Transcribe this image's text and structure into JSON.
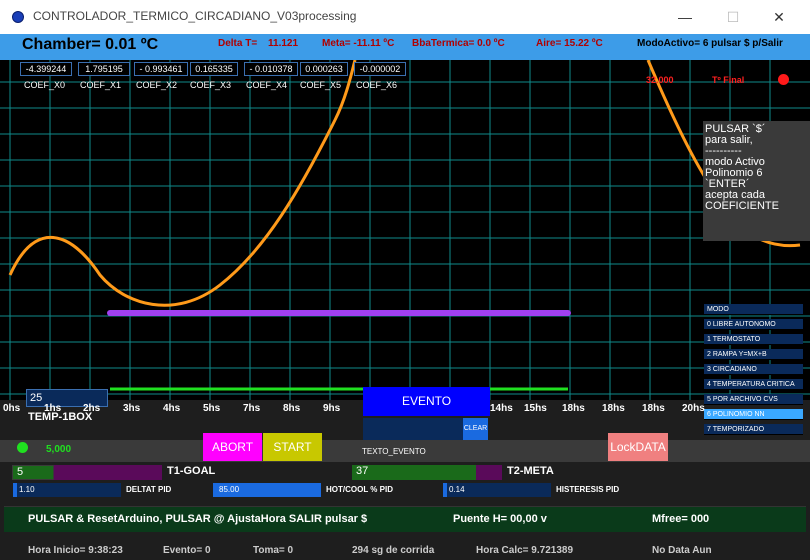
{
  "window": {
    "title": "CONTROLADOR_TERMICO_CIRCADIANO_V03processing",
    "minimize": "—",
    "maximize": "☐",
    "close": "✕"
  },
  "header": {
    "chamber": "Chamber= 0.01 ºC",
    "delta_label": "Delta T=",
    "delta_value": "11.121",
    "meta": "Meta= -11.11 ºC",
    "bba": "BbaTermica= 0.0 ºC",
    "aire": "Aire= 15.22 ºC",
    "modo": "ModoActivo= 6  pulsar $ p/Salir"
  },
  "coefficients": [
    {
      "value": "-4.399244",
      "label": "COEF_X0"
    },
    {
      "value": "1.795195",
      "label": "COEF_X1"
    },
    {
      "value": "- 0.993461",
      "label": "COEF_X2"
    },
    {
      "value": "0.165335",
      "label": "COEF_X3"
    },
    {
      "value": "- 0.010378",
      "label": "COEF_X4"
    },
    {
      "value": "0.000263",
      "label": "COEF_X5"
    },
    {
      "value": "-0.000002",
      "label": "COEF_X6"
    }
  ],
  "tfinal": {
    "value": "32.000",
    "label": "Tº Final"
  },
  "help_lines": [
    "PULSAR `$´",
    "para salir,",
    "----------",
    "modo Activo",
    "Polinomio   6",
    "  `ENTER´",
    "acepta cada",
    "COEFICIENTE"
  ],
  "modes": [
    "MODO",
    "0   LIBRE  AUTONOMO",
    "1 TERMOSTATO",
    "2 RAMPA Y=MX+B",
    "3 CIRCADIANO",
    "4 TEMPERATURA CRITICA",
    "5 POR ARCHIVO CVS",
    "6 POLINOMIO NN",
    "7 TEMPORIZADO"
  ],
  "selected_mode_index": 7,
  "temp1box": {
    "value": "25",
    "label": "TEMP-1BOX"
  },
  "hours": [
    "0hs",
    "1hs",
    "2hs",
    "3hs",
    "4hs",
    "5hs",
    "7hs",
    "8hs",
    "9hs",
    "14hs",
    "15hs",
    "18hs",
    "18hs",
    "18hs",
    "20hs"
  ],
  "evento": {
    "label": "EVENTO",
    "clear": "CLEAR",
    "texto_label": "TEXTO_EVENTO"
  },
  "status": {
    "value": "5,000"
  },
  "buttons": {
    "abort": "ABORT",
    "start": "START",
    "lock": "LockDATA"
  },
  "goals": {
    "t1_value": "5",
    "t1_label": "T1-GOAL",
    "t2_value": "37",
    "t2_label": "T2-META"
  },
  "pid": {
    "delta_value": "1.10",
    "delta_label": "DELTAT PID",
    "hotcool_value": "85.00",
    "hotcool_label": "HOT/COOL % PID",
    "hist_value": "0.14",
    "hist_label": "HISTERESIS PID"
  },
  "command_bar": {
    "text1": "PULSAR & ResetArduino,   PULSAR @ AjustaHora  SALIR pulsar $",
    "puente": "Puente H=  00,00 v",
    "mfree": "Mfree=    000"
  },
  "footer": {
    "hora_inicio": "Hora Inicio=  9:38:23",
    "evento": "Evento=  0",
    "toma": "Toma=   0",
    "corrida": "294 sg de corrida",
    "hora_calc": "Hora Calc= 9.721389",
    "no_data": "No Data Aun"
  },
  "colors": {
    "header_bg": "#3d9ce8",
    "grid": "#0f8a8a",
    "curve": "#ff9a1a",
    "purple_line": "#a040f0",
    "green_line": "#20e020",
    "abort": "#ff00ff",
    "start": "#c8c800",
    "lock": "#f08080"
  }
}
